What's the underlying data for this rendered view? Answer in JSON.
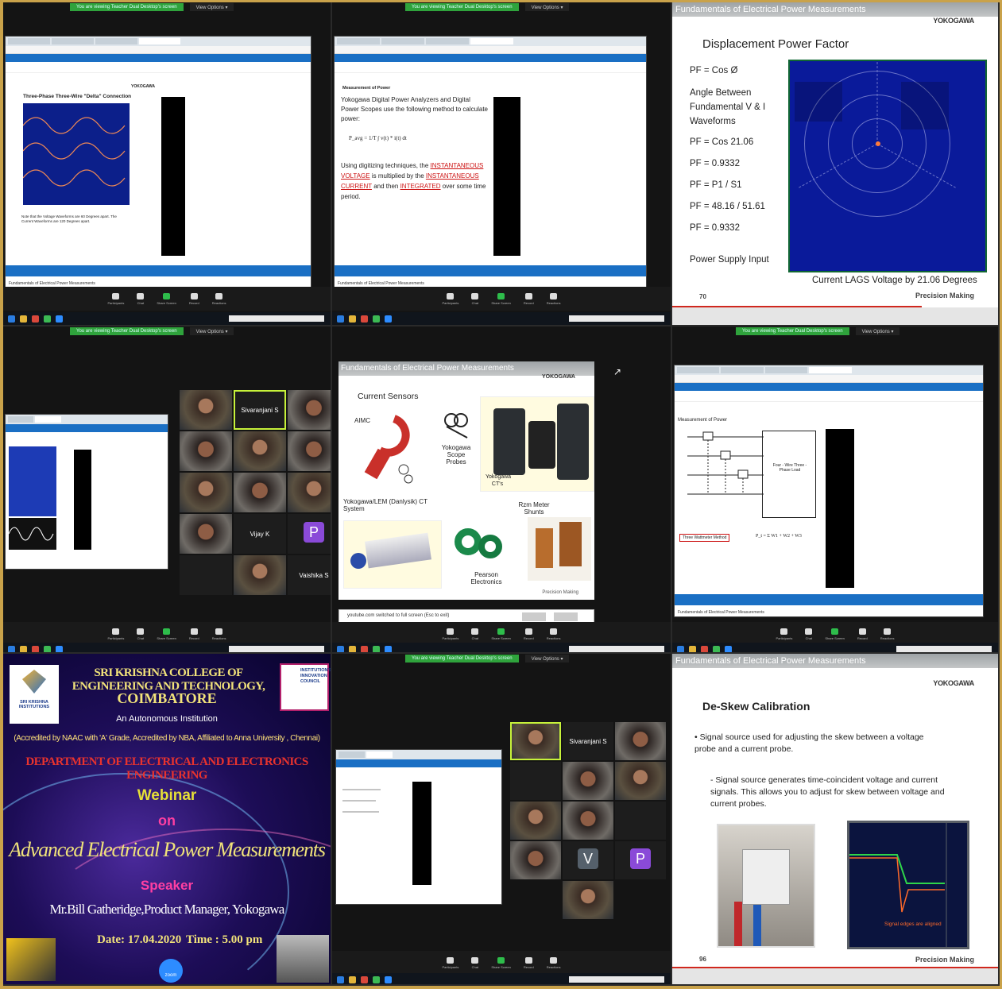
{
  "zoom_ui": {
    "banner_green": "You are viewing Teacher Dual Desktop's screen",
    "banner_options": "View Options ▾",
    "toolbar": [
      "Participants",
      "Chat",
      "Share Screen",
      "Record",
      "Reactions"
    ]
  },
  "tile1": {
    "slide_title": "Three-Phase Three-Wire \"Delta\" Connection",
    "slide_note": "Note that the Voltage Waveforms are 60 Degrees apart. The Current Waveforms are 120 Degrees apart.",
    "brand": "YOKOGAWA",
    "footer": "Fundamentals of Electrical Power Measurements"
  },
  "tile2": {
    "heading": "Measurement of Power",
    "bullet1": "Yokogawa Digital Power Analyzers and Digital Power Scopes use the following method to calculate power:",
    "formula": "P_avg = 1/T ∫ v(t) * i(t) dt",
    "bullet2_pre": "Using digitizing techniques, the",
    "bullet2_r1": "INSTANTANEOUS VOLTAGE",
    "bullet2_mid": "is multiplied by the",
    "bullet2_r2": "INSTANTANEOUS CURRENT",
    "bullet2_mid2": "and then",
    "bullet2_r3": "INTEGRATED",
    "bullet2_end": "over some time period.",
    "footer": "Fundamentals of Electrical Power Measurements"
  },
  "tile3": {
    "header": "Fundamentals of Electrical Power Measurements",
    "brand": "YOKOGAWA",
    "title": "Displacement Power Factor",
    "items": [
      "PF = Cos Ø",
      "Angle Between",
      "Fundamental V & I",
      "Waveforms",
      "PF = Cos 21.06",
      "PF = 0.9332",
      "PF = P1 / S1",
      "PF = 48.16 / 51.61",
      "PF = 0.9332"
    ],
    "power_supply": "Power Supply Input",
    "caption": "Current LAGS Voltage by 21.06 Degrees",
    "precision": "Precision Making",
    "page": "70"
  },
  "tile4": {
    "participants": [
      "Sivaranjani S",
      "Vijay K",
      "Vaishika S"
    ]
  },
  "tile5": {
    "header": "Fundamentals of Electrical Power Measurements",
    "brand": "YOKOGAWA",
    "title": "Current Sensors",
    "aimc": "AIMC",
    "probes": "Yokogawa Scope Probes",
    "ct": "Yokogawa CT's",
    "lem": "Yokogawa/LEM (Danlysik) CT System",
    "shunts": "Rzm Meter Shunts",
    "pearson": "Pearson Electronics",
    "precision": "Precision Making",
    "notice": "youtube.com switched to full screen (Esc to exit)"
  },
  "tile6": {
    "heading": "Measurement of Power",
    "load_label": "Four - Wire Three - Phase Load",
    "method": "Three Wattmeter Method",
    "formula": "P_t = Σ W1 + W2 + W3",
    "footer": "Fundamentals of Electrical Power Measurements"
  },
  "tile7": {
    "college": "SRI KRISHNA COLLEGE OF ENGINEERING AND TECHNOLOGY,",
    "city": "COIMBATORE",
    "autonomous": "An Autonomous Institution",
    "accreditation": "(Accredited by NAAC with 'A' Grade, Accredited by NBA, Affiliated to Anna University , Chennai)",
    "department": "DEPARTMENT OF ELECTRICAL AND ELECTRONICS ENGINEERING",
    "webinar": "Webinar",
    "on": "on",
    "topic": "Advanced Electrical Power Measurements",
    "speaker_label": "Speaker",
    "speaker": "Mr.Bill Gatheridge,Product Manager, Yokogawa",
    "date": "Date: 17.04.2020",
    "time": "Time : 5.00 pm",
    "logo_left": "SRI KRISHNA INSTITUTIONS",
    "logo_right": "INSTITUTION'S INNOVATION COUNCIL",
    "zoom": "zoom"
  },
  "tile8": {
    "participants": [
      "Sivaranjani S",
      "V",
      "P"
    ]
  },
  "tile9": {
    "header": "Fundamentals of Electrical Power Measurements",
    "brand": "YOKOGAWA",
    "title": "De-Skew Calibration",
    "bullet1": "• Signal source used for adjusting the skew between a voltage probe and a current probe.",
    "bullet2": "- Signal source generates time-coincident voltage and current signals. This allows you to adjust for skew between voltage and current probes.",
    "wave_caption": "Signal edges are aligned",
    "precision": "Precision Making",
    "page": "96"
  },
  "colors": {
    "frame": "#c9a24a",
    "zoom_green": "#2fa33c",
    "accent_red": "#d0281e",
    "speaking": "#c7f23a"
  }
}
